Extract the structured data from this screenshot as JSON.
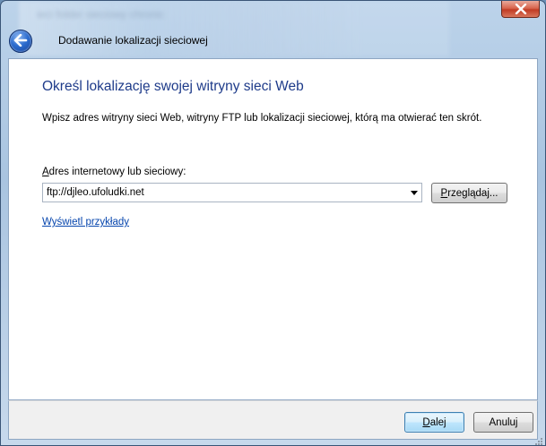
{
  "window": {
    "title": "Dodawanie lokalizacji sieciowej",
    "background_ghost_text": "ieci folder sieciowy chronic"
  },
  "page": {
    "heading": "Określ lokalizację swojej witryny sieci Web",
    "description": "Wpisz adres witryny sieci Web, witryny FTP lub lokalizacji sieciowej, którą ma otwierać ten skrót.",
    "address_label_accel": "A",
    "address_label_rest": "dres internetowy lub sieciowy:",
    "address_value": "ftp://djleo.ufoludki.net",
    "browse_accel": "P",
    "browse_rest": "rzeglądaj...",
    "examples_link": "Wyświetl przykłady"
  },
  "footer": {
    "next_accel": "D",
    "next_rest": "alej",
    "cancel_label": "Anuluj"
  },
  "colors": {
    "heading": "#1e3b8a",
    "link": "#0645ad",
    "close_button": "#c13c24",
    "back_button": "#2e6ed0"
  },
  "icons": [
    "close-icon",
    "back-arrow-icon",
    "dropdown-arrow-icon",
    "resize-grip-icon"
  ]
}
